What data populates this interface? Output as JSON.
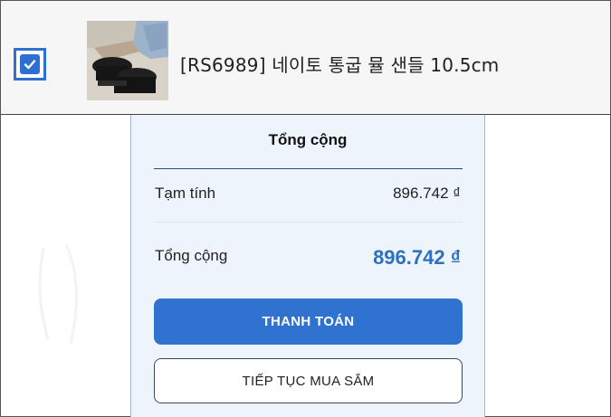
{
  "cart_item": {
    "checked": true,
    "title": "[RS6989] 네이토 통굽 뮬 샌들 10.5cm",
    "thumbnail_icon": "sandal-product-photo"
  },
  "summary": {
    "title": "Tổng cộng",
    "subtotal_label": "Tạm tính",
    "subtotal_value": "896.742 ₫",
    "total_label": "Tổng cộng",
    "total_value": "896.742 ₫",
    "pay_button": "THANH TOÁN",
    "continue_button": "TIẾP TỤC MUA SẮM"
  },
  "colors": {
    "accent": "#2f72d0",
    "total_text": "#2f6fc0",
    "panel_bg": "#eef4fc"
  }
}
